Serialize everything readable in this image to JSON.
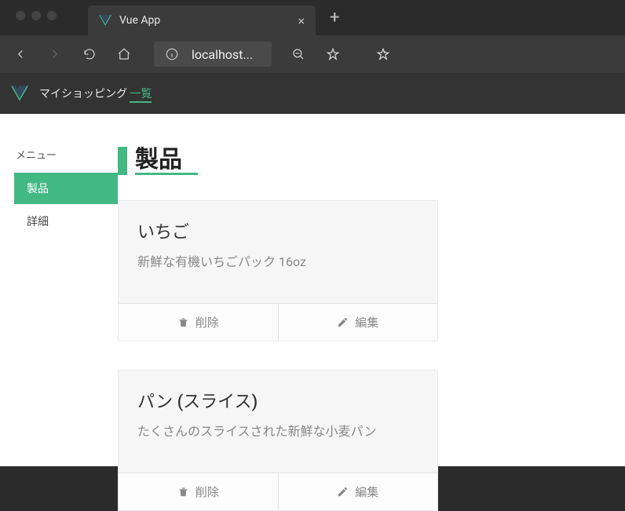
{
  "browser": {
    "tab_title": "Vue App",
    "address": "localhost..."
  },
  "navbar": {
    "title_prefix": "マイショッピング ",
    "title_accent": "一覧"
  },
  "sidebar": {
    "heading": "メニュー",
    "items": [
      {
        "label": "製品",
        "active": true
      },
      {
        "label": "詳細",
        "active": false
      }
    ]
  },
  "page": {
    "title": "製品"
  },
  "products": [
    {
      "name": "いちご",
      "description": "新鮮な有機いちごパック 16oz"
    },
    {
      "name": "パン (スライス)",
      "description": "たくさんのスライスされた新鮮な小麦パン"
    }
  ],
  "actions": {
    "delete": "削除",
    "edit": "編集"
  },
  "colors": {
    "accent": "#42b883",
    "chrome_bg": "#2b2b2b",
    "navbar_bg": "#333333",
    "card_bg": "#f6f6f6"
  }
}
